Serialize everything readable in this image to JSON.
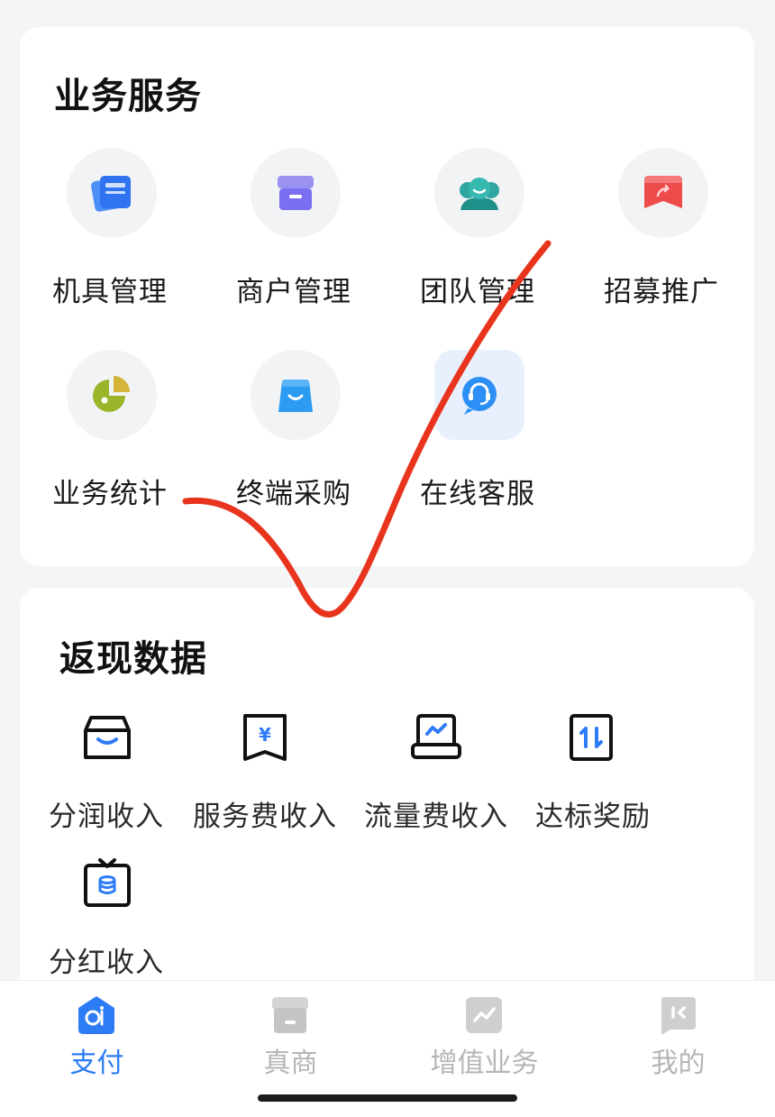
{
  "services": {
    "title": "业务服务",
    "items": [
      {
        "label": "机具管理",
        "icon": "device-cards-icon"
      },
      {
        "label": "商户管理",
        "icon": "shop-box-icon"
      },
      {
        "label": "团队管理",
        "icon": "team-people-icon"
      },
      {
        "label": "招募推广",
        "icon": "share-envelope-icon"
      },
      {
        "label": "业务统计",
        "icon": "pie-chart-icon"
      },
      {
        "label": "终端采购",
        "icon": "shopping-bag-icon"
      },
      {
        "label": "在线客服",
        "icon": "customer-service-icon"
      }
    ]
  },
  "rebate": {
    "title": "返现数据",
    "items": [
      {
        "label": "分润收入",
        "icon": "basket-icon"
      },
      {
        "label": "服务费收入",
        "icon": "yen-receipt-icon"
      },
      {
        "label": "流量费收入",
        "icon": "traffic-terminal-icon"
      },
      {
        "label": "达标奖励",
        "icon": "exchange-arrows-icon"
      },
      {
        "label": "分红收入",
        "icon": "coin-clipboard-icon"
      }
    ]
  },
  "tabbar": {
    "items": [
      {
        "label": "支付",
        "icon": "pay-home-icon",
        "active": true
      },
      {
        "label": "真商",
        "icon": "store-icon",
        "active": false
      },
      {
        "label": "增值业务",
        "icon": "growth-chart-icon",
        "active": false
      },
      {
        "label": "我的",
        "icon": "profile-icon",
        "active": false
      }
    ]
  },
  "colors": {
    "accent": "#2d7cf6",
    "inactive": "#b5b5b5",
    "annotation_red": "#e8341c"
  }
}
